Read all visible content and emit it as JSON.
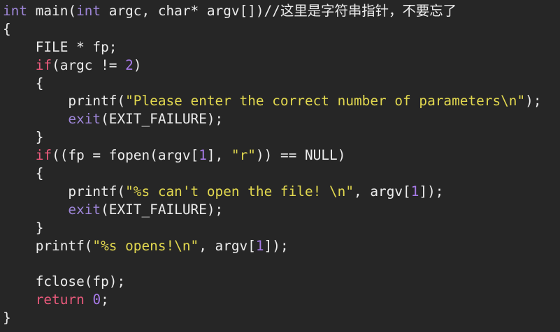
{
  "editor": {
    "lines": [
      [
        {
          "t": "int",
          "c": "kw"
        },
        {
          "t": " main(",
          "c": "plain"
        },
        {
          "t": "int",
          "c": "kw"
        },
        {
          "t": " argc, char* argv[])",
          "c": "plain"
        },
        {
          "t": "//这里是字符串指针，不要忘了",
          "c": "cmt"
        }
      ],
      [
        {
          "t": "{",
          "c": "plain"
        }
      ],
      [
        {
          "t": "    FILE * fp;",
          "c": "plain"
        }
      ],
      [
        {
          "t": "    ",
          "c": "plain"
        },
        {
          "t": "if",
          "c": "ctrl"
        },
        {
          "t": "(argc != ",
          "c": "plain"
        },
        {
          "t": "2",
          "c": "num"
        },
        {
          "t": ")",
          "c": "plain"
        }
      ],
      [
        {
          "t": "    {",
          "c": "plain"
        }
      ],
      [
        {
          "t": "        printf(",
          "c": "plain"
        },
        {
          "t": "\"Please enter the correct number of parameters\\n\"",
          "c": "str"
        },
        {
          "t": ");",
          "c": "plain"
        }
      ],
      [
        {
          "t": "        ",
          "c": "plain"
        },
        {
          "t": "exit",
          "c": "kw"
        },
        {
          "t": "(EXIT_FAILURE);",
          "c": "plain"
        }
      ],
      [
        {
          "t": "    }",
          "c": "plain"
        }
      ],
      [
        {
          "t": "    ",
          "c": "plain"
        },
        {
          "t": "if",
          "c": "ctrl"
        },
        {
          "t": "((fp = fopen(argv[",
          "c": "plain"
        },
        {
          "t": "1",
          "c": "num"
        },
        {
          "t": "], ",
          "c": "plain"
        },
        {
          "t": "\"r\"",
          "c": "str"
        },
        {
          "t": ")) == NULL)",
          "c": "plain"
        }
      ],
      [
        {
          "t": "    {",
          "c": "plain"
        }
      ],
      [
        {
          "t": "        printf(",
          "c": "plain"
        },
        {
          "t": "\"%s can't open the file! \\n\"",
          "c": "str"
        },
        {
          "t": ", argv[",
          "c": "plain"
        },
        {
          "t": "1",
          "c": "num"
        },
        {
          "t": "]);",
          "c": "plain"
        }
      ],
      [
        {
          "t": "        ",
          "c": "plain"
        },
        {
          "t": "exit",
          "c": "kw"
        },
        {
          "t": "(EXIT_FAILURE);",
          "c": "plain"
        }
      ],
      [
        {
          "t": "    }",
          "c": "plain"
        }
      ],
      [
        {
          "t": "    printf(",
          "c": "plain"
        },
        {
          "t": "\"%s opens!\\n\"",
          "c": "str"
        },
        {
          "t": ", argv[",
          "c": "plain"
        },
        {
          "t": "1",
          "c": "num"
        },
        {
          "t": "]);",
          "c": "plain"
        }
      ],
      [
        {
          "t": "",
          "c": "plain"
        }
      ],
      [
        {
          "t": "    fclose(fp);",
          "c": "plain"
        }
      ],
      [
        {
          "t": "    ",
          "c": "plain"
        },
        {
          "t": "return",
          "c": "ctrl"
        },
        {
          "t": " ",
          "c": "plain"
        },
        {
          "t": "0",
          "c": "num"
        },
        {
          "t": ";",
          "c": "plain"
        }
      ],
      [
        {
          "t": "}",
          "c": "plain"
        }
      ]
    ]
  },
  "colors": {
    "background": "#262626",
    "type_keyword": "#9e86d8",
    "control_keyword": "#ea5a7c",
    "string": "#e2d84f",
    "number": "#a77ae8",
    "plain": "#ececec"
  }
}
